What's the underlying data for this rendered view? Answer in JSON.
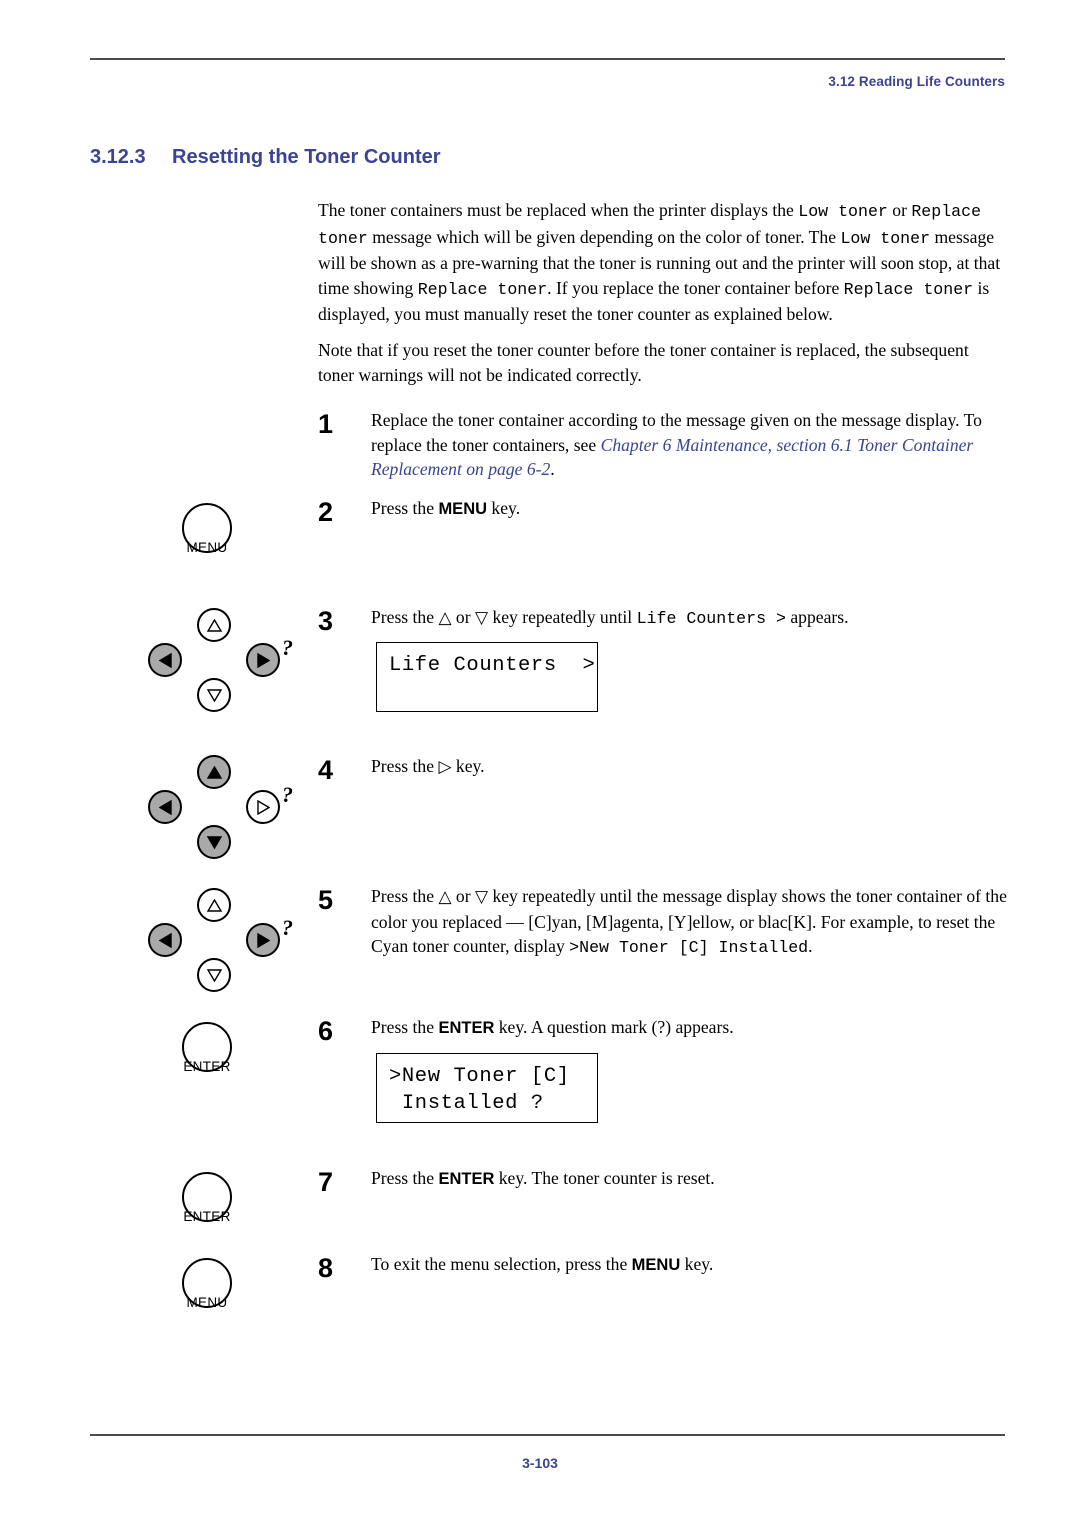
{
  "header": {
    "running_head": "3.12 Reading Life Counters"
  },
  "heading": {
    "number": "3.12.3",
    "title": "Resetting the Toner Counter"
  },
  "intro": {
    "paragraph1_part1": "The toner containers must be replaced when the printer displays the ",
    "msg_low_toner_a": "Low toner",
    "paragraph1_part2": " or ",
    "msg_replace_toner_a": "Replace toner",
    "paragraph1_part3": " message which will be given depending on the color of toner. The ",
    "msg_low_toner_b": "Low toner",
    "paragraph1_part4": " message will be shown as a pre-warning that the toner is running out and the printer will soon stop, at that time showing ",
    "msg_replace_toner_b": "Replace toner",
    "paragraph1_part5": ". If you replace the toner container before ",
    "msg_replace_toner_c": "Replace toner",
    "paragraph1_part6": " is displayed, you must manually reset the toner counter as explained below.",
    "paragraph2": "Note that if you reset the toner counter before the toner container is replaced, the subsequent toner warnings will not be indicated correctly."
  },
  "steps": [
    {
      "number": "1",
      "text_part1": "Replace the toner container according to the message given on the message display. To replace the toner containers, see ",
      "xref": "Chapter 6 Maintenance, section 6.1 Toner Container Replacement on page 6-2",
      "text_part2": "."
    },
    {
      "number": "2",
      "text_part1": "Press the ",
      "key": "MENU",
      "text_part2": " key."
    },
    {
      "number": "3",
      "text_part1": "Press the ",
      "arrow_up": "△",
      "text_part2": " or ",
      "arrow_down": "▽",
      "text_part3": " key repeatedly until ",
      "mono": "Life Counters >",
      "text_part4": " appears."
    },
    {
      "number": "4",
      "text_part1": "Press the ",
      "arrow_right": "▷",
      "text_part2": " key."
    },
    {
      "number": "5",
      "text_part1": "Press the ",
      "arrow_up": "△",
      "text_part2": " or ",
      "arrow_down": "▽",
      "text_part3": " key repeatedly until the message display shows the toner container of the color you replaced — [C]yan, [M]agenta, [Y]ellow, or blac[K]. For example, to reset the Cyan toner counter, display ",
      "mono": ">New Toner [C] Installed",
      "text_part4": "."
    },
    {
      "number": "6",
      "text_part1": "Press the ",
      "key": "ENTER",
      "text_part2": " key. A question mark (?) appears."
    },
    {
      "number": "7",
      "text_part1": "Press the ",
      "key": "ENTER",
      "text_part2": " key. The toner counter is reset."
    },
    {
      "number": "8",
      "text_part1": "To exit the menu selection, press the ",
      "key": "MENU",
      "text_part2": " key."
    }
  ],
  "displays": {
    "life_counters": "Life Counters  >",
    "new_toner_line1": ">New Toner [C]",
    "new_toner_line2": " Installed ?"
  },
  "panel_keys": {
    "menu_label": "MENU",
    "enter_label": "ENTER",
    "question_mark": "?"
  },
  "colors": {
    "accent_blue": "#3b4395",
    "key_fill_gray": "#a9a9a9",
    "rule_gray": "#4a4a4a"
  },
  "footer": {
    "page_number": "3-103"
  }
}
